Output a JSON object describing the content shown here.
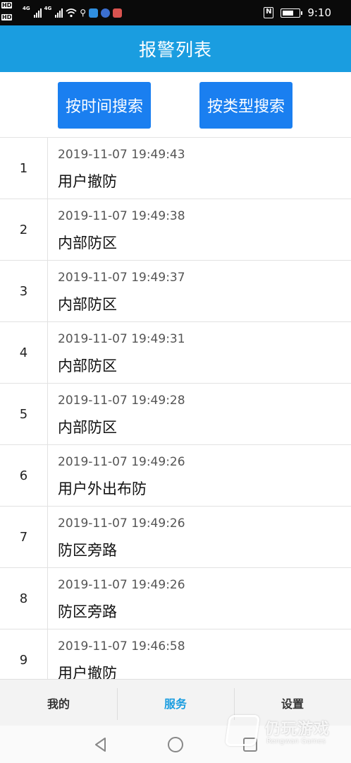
{
  "status_bar": {
    "hd_label": "HD",
    "network_1": "4G",
    "network_2": "4G",
    "time": "9:10",
    "nfc_label": "N",
    "battery_level": 0.72,
    "app_icon_colors": [
      "#2f8fe0",
      "#3b6fd1",
      "#d9534f"
    ]
  },
  "header": {
    "title": "报警列表"
  },
  "search": {
    "by_time_label": "按时间搜索",
    "by_type_label": "按类型搜索"
  },
  "alarms": [
    {
      "index": "1",
      "time": "2019-11-07 19:49:43",
      "type": "用户撤防"
    },
    {
      "index": "2",
      "time": "2019-11-07 19:49:38",
      "type": "内部防区"
    },
    {
      "index": "3",
      "time": "2019-11-07 19:49:37",
      "type": "内部防区"
    },
    {
      "index": "4",
      "time": "2019-11-07 19:49:31",
      "type": "内部防区"
    },
    {
      "index": "5",
      "time": "2019-11-07 19:49:28",
      "type": "内部防区"
    },
    {
      "index": "6",
      "time": "2019-11-07 19:49:26",
      "type": "用户外出布防"
    },
    {
      "index": "7",
      "time": "2019-11-07 19:49:26",
      "type": "防区旁路"
    },
    {
      "index": "8",
      "time": "2019-11-07 19:49:26",
      "type": "防区旁路"
    },
    {
      "index": "9",
      "time": "2019-11-07 19:46:58",
      "type": "用户撤防"
    }
  ],
  "tabs": {
    "mine": "我的",
    "service": "服务",
    "settings": "设置"
  },
  "watermark": {
    "name": "仍玩游戏",
    "sub": "Rengwan Games"
  },
  "colors": {
    "header": "#1a9de0",
    "button": "#1a7ff0",
    "active_tab": "#1a9de0"
  }
}
